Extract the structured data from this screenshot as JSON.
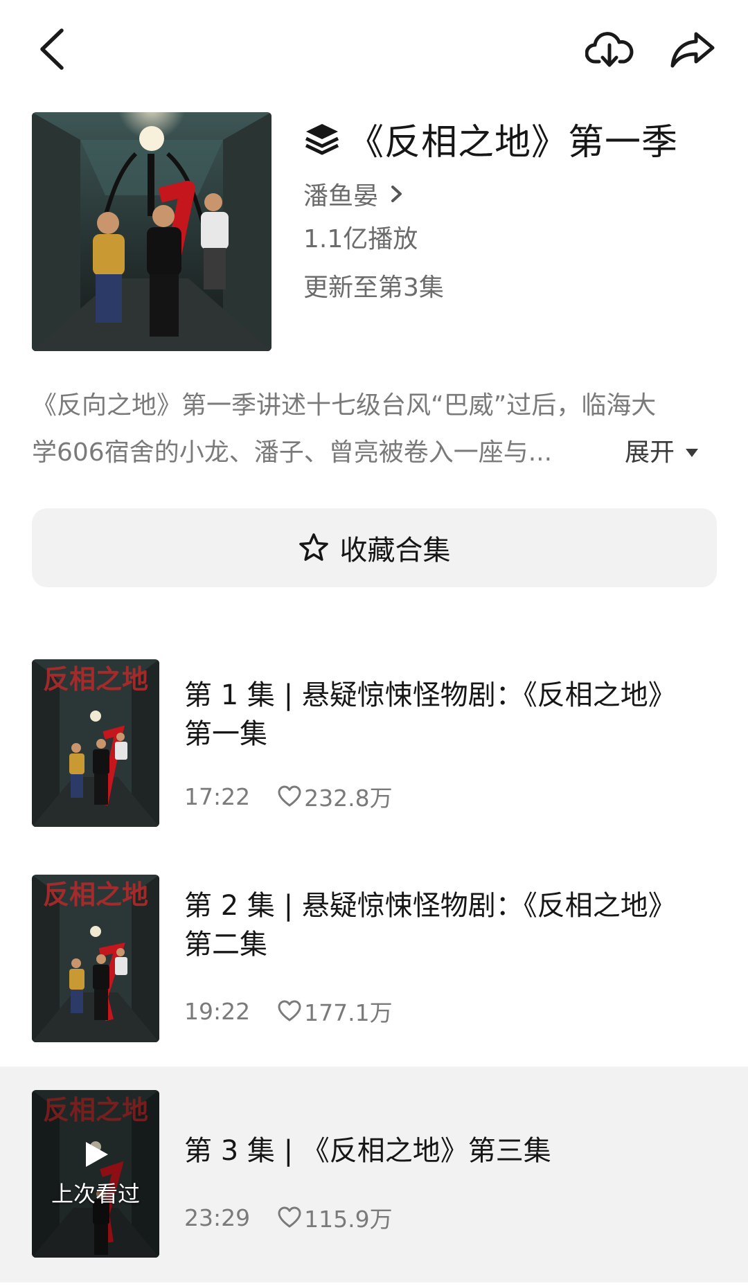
{
  "header": {
    "icons": [
      "back-icon",
      "download-icon",
      "share-icon"
    ]
  },
  "collection": {
    "title": "《反相之地》第一季",
    "title_icon": "layers-icon",
    "author": "潘鱼晏",
    "plays": "1.1亿播放",
    "update_status": "更新至第3集",
    "description_line1": "《反向之地》第一季讲述十七级台风“巴威”过后，临海大",
    "description_line2": "学606宿舍的小龙、潘子、曾亮被卷入一座与...",
    "expand_label": "展开",
    "collect_label": "收藏合集"
  },
  "episodes": [
    {
      "title_line1": "第 1 集 | 悬疑惊悚怪物剧：《反相之地》",
      "title_line2": "第一集",
      "duration": "17:22",
      "likes": "232.8万",
      "thumb_text": "反相之地"
    },
    {
      "title_line1": "第 2 集 | 悬疑惊悚怪物剧：《反相之地》",
      "title_line2": "第二集",
      "duration": "19:22",
      "likes": "177.1万",
      "thumb_text": "反相之地"
    },
    {
      "title_line1": "第 3 集 | 《反相之地》第三集",
      "title_line2": "",
      "duration": "23:29",
      "likes": "115.9万",
      "thumb_text": "反相之地",
      "last_watched_label": "上次看过"
    }
  ],
  "colors": {
    "background": "#ffffff",
    "text_primary": "#161616",
    "text_secondary": "#7a7a7a",
    "button_bg": "#f2f2f2",
    "highlight_row": "#f2f2f2",
    "poster_accent": "#c4161c"
  }
}
